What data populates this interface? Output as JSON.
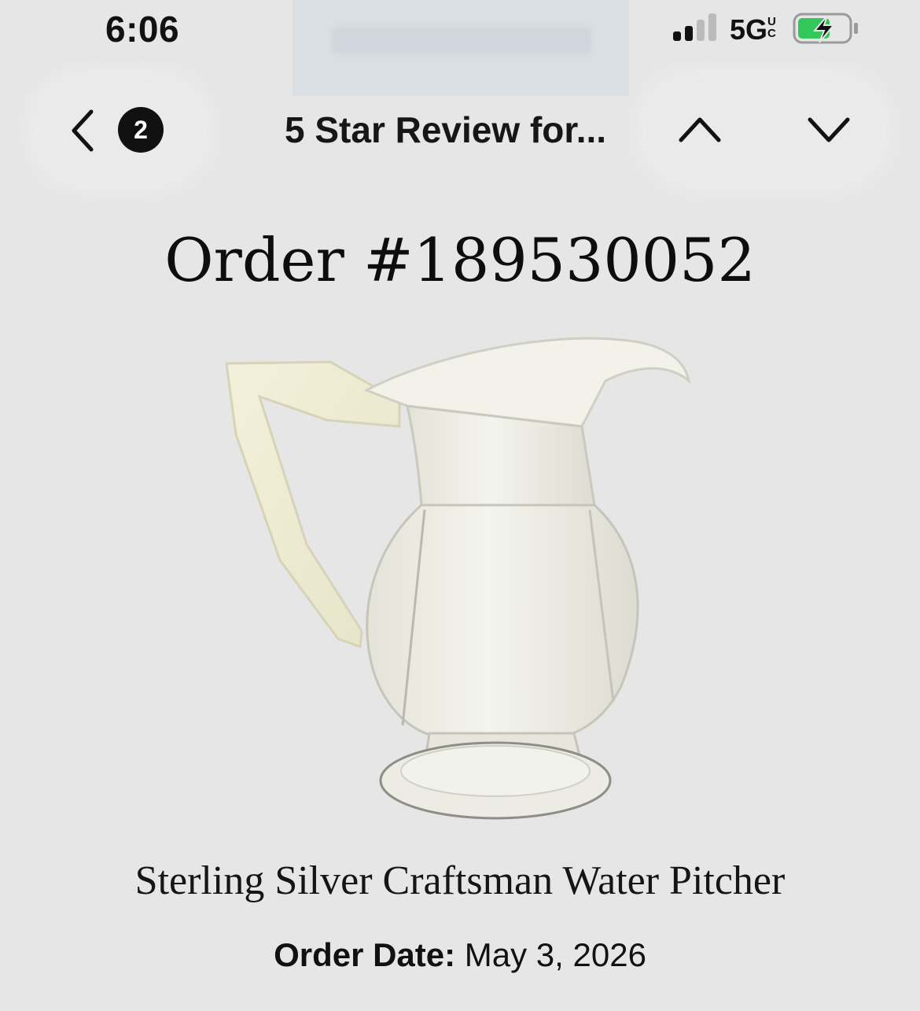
{
  "status_bar": {
    "time": "6:06",
    "network": "5G",
    "network_suffix": "UC",
    "signal_bars": 2,
    "battery_charging": true
  },
  "nav": {
    "unread_count": "2",
    "title": "5 Star Review for...",
    "icons": [
      "chevron-left-icon",
      "chevron-up-icon",
      "chevron-down-icon"
    ]
  },
  "order": {
    "title": "Order #189530052",
    "product_name": "Sterling Silver Craftsman Water Pitcher",
    "date_label": "Order Date:",
    "date_value": " May 3, 2026"
  },
  "colors": {
    "background": "#e6e6e6",
    "battery_fill": "#34c759",
    "text": "#111111"
  }
}
